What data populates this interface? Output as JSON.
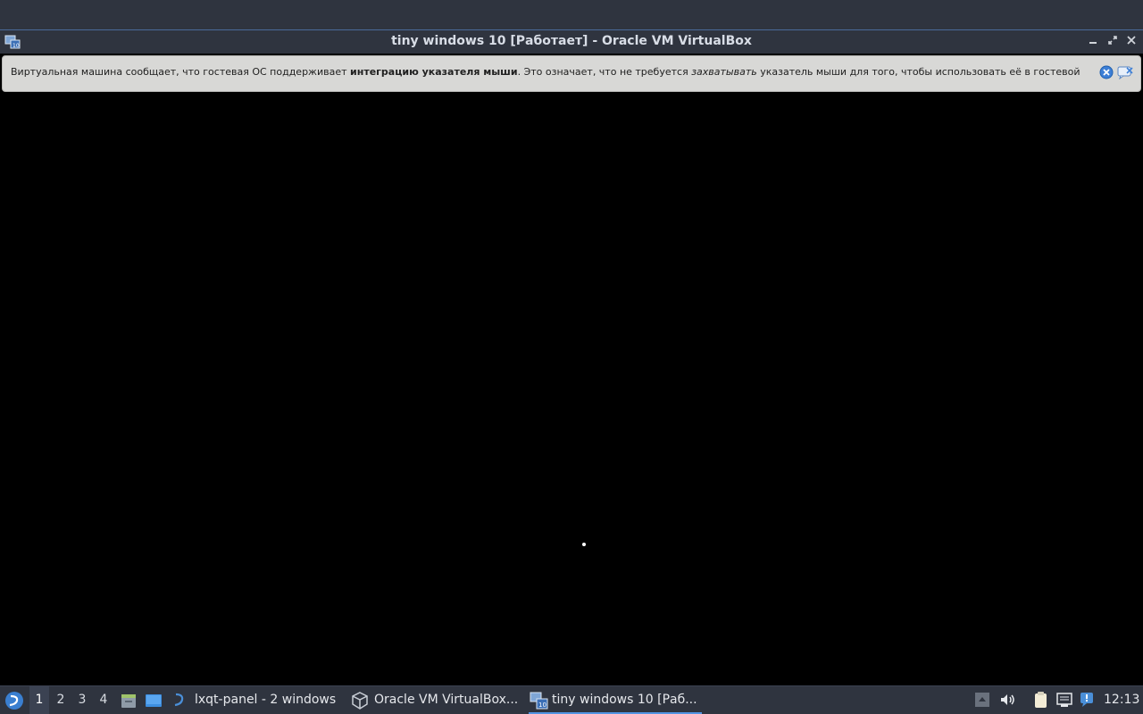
{
  "window": {
    "title": "tiny windows 10 [Работает] - Oracle VM VirtualBox",
    "minimize_icon": "minimize-icon",
    "maximize_icon": "restore-icon",
    "close_icon": "close-icon"
  },
  "notice": {
    "text_1": "Виртуальная машина сообщает, что гостевая ОС поддерживает ",
    "bold": "интеграцию указателя мыши",
    "text_2": ". Это означает, что не требуется ",
    "italic": "захватывать",
    "text_3": " указатель мыши для того, чтобы использовать её в гостевой",
    "close_icon": "close-circle-icon",
    "hide_icon": "hide-message-icon"
  },
  "taskbar": {
    "workspaces": [
      "1",
      "2",
      "3",
      "4"
    ],
    "active_workspace": "1",
    "tasks": [
      {
        "label": "lxqt-panel - 2 windows",
        "icon": "lxqt-icon"
      },
      {
        "label": "Oracle VM VirtualBox...",
        "icon": "virtualbox-icon"
      },
      {
        "label": "tiny windows 10 [Раб...",
        "icon": "vm-window-icon"
      }
    ],
    "clock": "12:13"
  },
  "colors": {
    "panel": "#2f343f",
    "accent": "#5294e2",
    "notice_bg": "#d8d8d6",
    "vm_screen": "#000000"
  }
}
